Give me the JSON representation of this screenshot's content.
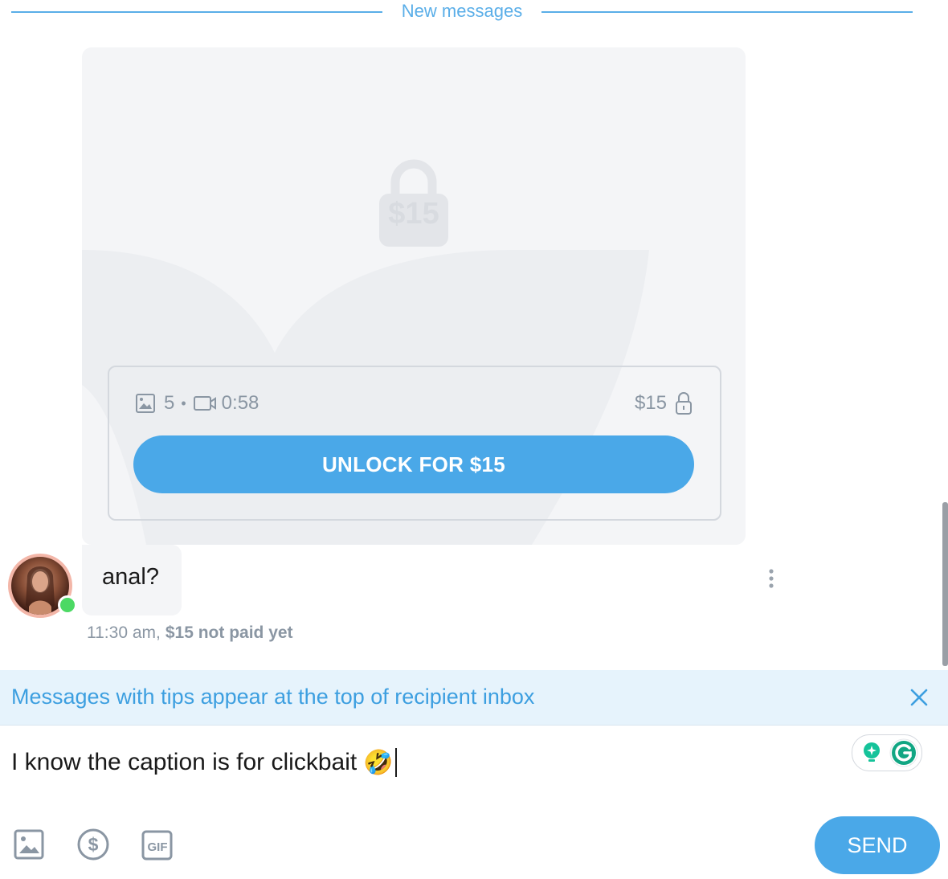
{
  "divider": {
    "label": "New messages"
  },
  "locked_post": {
    "lock_price": "$15",
    "photo_count": "5",
    "separator": "•",
    "video_duration": "0:58",
    "price": "$15",
    "unlock_label": "UNLOCK FOR $15"
  },
  "message": {
    "text": "anal?",
    "time": "11:30 am,",
    "payment_status": "$15 not paid yet"
  },
  "tip_banner": {
    "text": "Messages with tips appear at the top of recipient inbox"
  },
  "composer": {
    "text": "I know the caption is for clickbait",
    "emoji": "🤣",
    "send_label": "SEND"
  },
  "icons": [
    "image-icon",
    "video-icon",
    "lock-icon",
    "more-vertical-icon",
    "close-icon",
    "dollar-icon",
    "gif-icon",
    "grammarly-icon"
  ],
  "colors": {
    "accent": "#4aa8e8",
    "banner_bg": "#e6f3fc",
    "muted": "#8a96a3",
    "online": "#4cd964"
  }
}
